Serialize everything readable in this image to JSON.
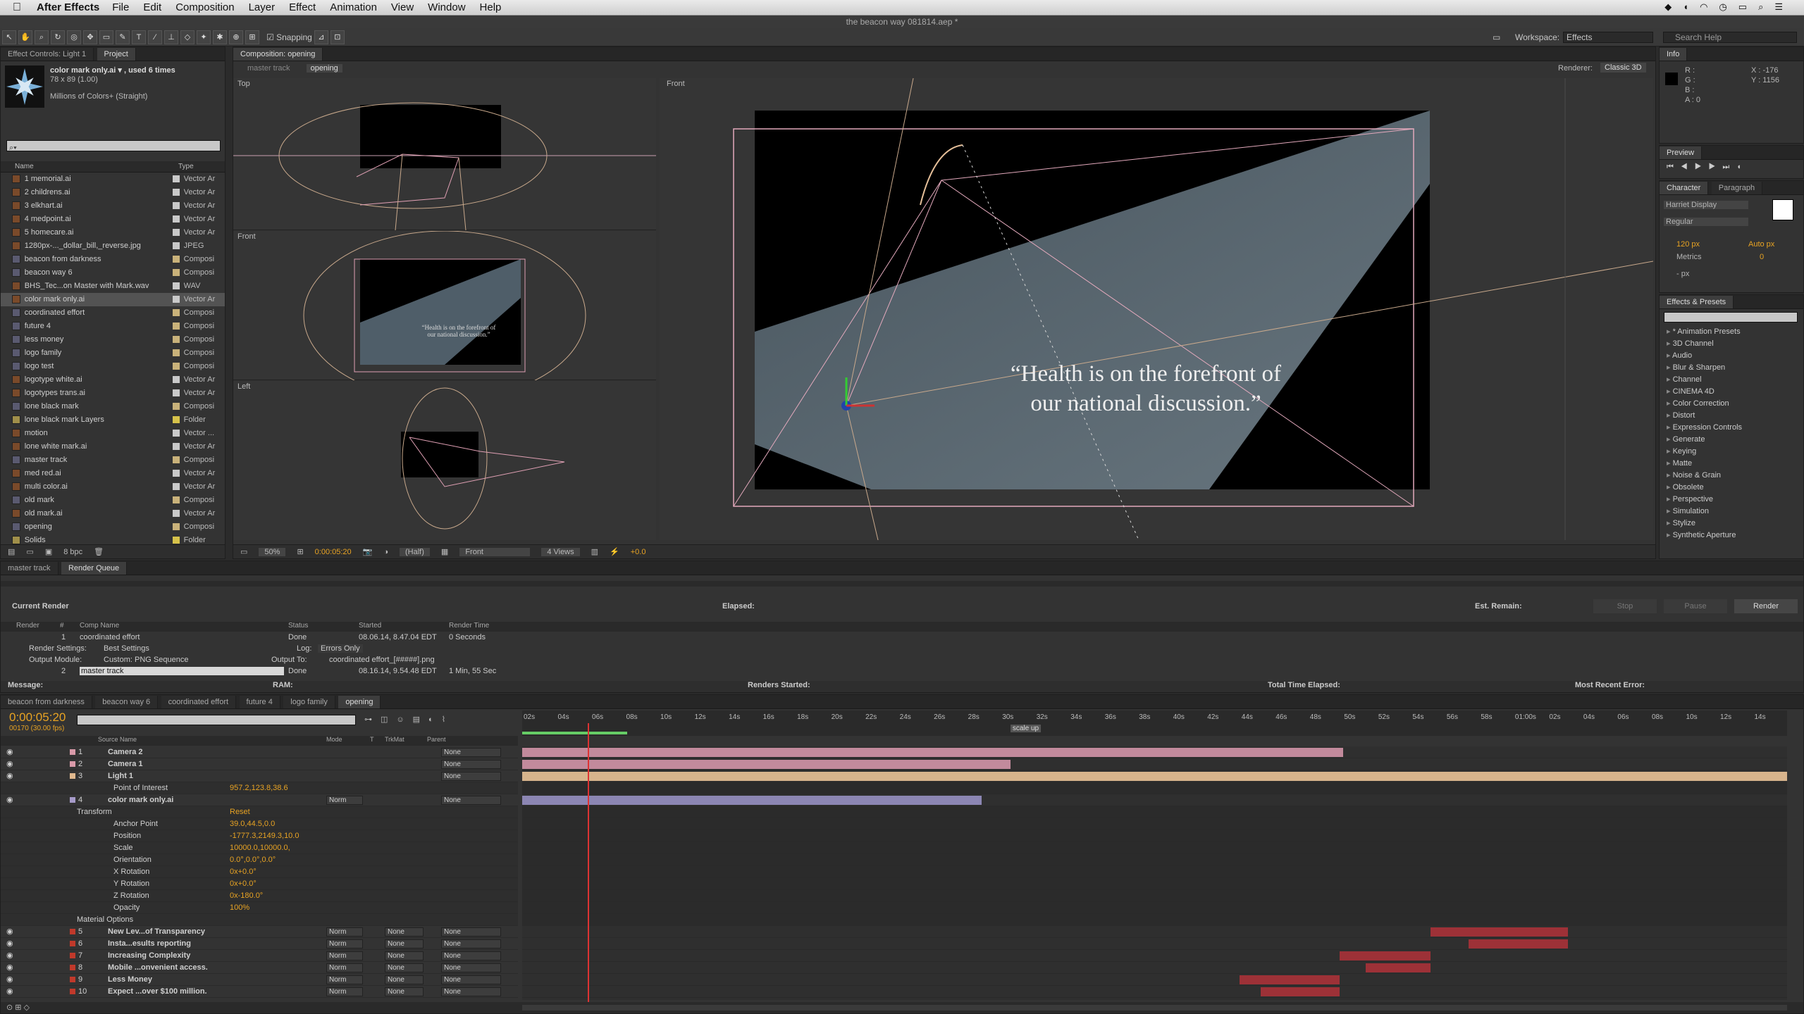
{
  "menubar": {
    "app": "After Effects",
    "items": [
      "File",
      "Edit",
      "Composition",
      "Layer",
      "Effect",
      "Animation",
      "View",
      "Window",
      "Help"
    ]
  },
  "window": {
    "title": "the beacon way 081814.aep *"
  },
  "toolbar": {
    "snapping": "Snapping",
    "workspace_label": "Workspace:",
    "workspace_value": "Effects",
    "search_help": "Search Help"
  },
  "project": {
    "tabs": [
      "Effect Controls: Light 1",
      "Project"
    ],
    "selected_item": {
      "name": "color mark only.ai ▾ , used 6 times",
      "dims": "78 x 89 (1.00)",
      "colors": "Millions of Colors+ (Straight)"
    },
    "col_name": "Name",
    "col_type": "Type",
    "items": [
      {
        "name": "1 memorial.ai",
        "type": "Vector Ar",
        "color": "#c9c9c9"
      },
      {
        "name": "2 childrens.ai",
        "type": "Vector Ar",
        "color": "#c9c9c9"
      },
      {
        "name": "3 elkhart.ai",
        "type": "Vector Ar",
        "color": "#c9c9c9"
      },
      {
        "name": "4 medpoint.ai",
        "type": "Vector Ar",
        "color": "#c9c9c9"
      },
      {
        "name": "5 homecare.ai",
        "type": "Vector Ar",
        "color": "#c9c9c9"
      },
      {
        "name": "1280px-..._dollar_bill,_reverse.jpg",
        "type": "JPEG",
        "color": "#c9c9c9"
      },
      {
        "name": "beacon from darkness",
        "type": "Composi",
        "color": "#c9b27a"
      },
      {
        "name": "beacon way 6",
        "type": "Composi",
        "color": "#c9b27a"
      },
      {
        "name": "BHS_Tec...on Master with Mark.wav",
        "type": "WAV",
        "color": "#c9c9c9"
      },
      {
        "name": "color mark only.ai",
        "type": "Vector Ar",
        "color": "#c9c9c9",
        "selected": true
      },
      {
        "name": "coordinated effort",
        "type": "Composi",
        "color": "#c9b27a"
      },
      {
        "name": "future 4",
        "type": "Composi",
        "color": "#c9b27a"
      },
      {
        "name": "less money",
        "type": "Composi",
        "color": "#c9b27a"
      },
      {
        "name": "logo family",
        "type": "Composi",
        "color": "#c9b27a"
      },
      {
        "name": "logo test",
        "type": "Composi",
        "color": "#c9b27a"
      },
      {
        "name": "logotype white.ai",
        "type": "Vector Ar",
        "color": "#c9c9c9"
      },
      {
        "name": "logotypes trans.ai",
        "type": "Vector Ar",
        "color": "#c9c9c9"
      },
      {
        "name": "lone black mark",
        "type": "Composi",
        "color": "#c9b27a"
      },
      {
        "name": "lone black mark Layers",
        "type": "Folder",
        "color": "#d6c24a"
      },
      {
        "name": "motion",
        "type": "Vector ...",
        "color": "#c9c9c9"
      },
      {
        "name": "lone white mark.ai",
        "type": "Vector Ar",
        "color": "#c9c9c9"
      },
      {
        "name": "master track",
        "type": "Composi",
        "color": "#c9b27a"
      },
      {
        "name": "med red.ai",
        "type": "Vector Ar",
        "color": "#c9c9c9"
      },
      {
        "name": "multi color.ai",
        "type": "Vector Ar",
        "color": "#c9c9c9"
      },
      {
        "name": "old mark",
        "type": "Composi",
        "color": "#c9b27a"
      },
      {
        "name": "old mark.ai",
        "type": "Vector Ar",
        "color": "#c9c9c9"
      },
      {
        "name": "opening",
        "type": "Composi",
        "color": "#c9b27a"
      },
      {
        "name": "Solids",
        "type": "Folder",
        "color": "#d6c24a"
      }
    ],
    "bpc": "8 bpc"
  },
  "comp": {
    "tab": "Composition: opening",
    "breadcrumbs": [
      "master track",
      "opening"
    ],
    "renderer_label": "Renderer:",
    "renderer": "Classic 3D",
    "views": {
      "top": "Top",
      "front_small": "Front",
      "left": "Left",
      "front_big": "Front"
    },
    "quote": "“Health is on the forefront of our national discussion.”",
    "quote_line1": "“Health is on the forefront of",
    "quote_line2": "our national discussion.”",
    "bottom": {
      "zoom": "50%",
      "time": "0:00:05:20",
      "res": "(Half)",
      "view": "Front",
      "layout": "4 Views",
      "exposure": "+0.0"
    }
  },
  "info": {
    "tab": "Info",
    "r": "R :",
    "g": "G :",
    "b": "B :",
    "a": "A : 0",
    "x": "X : -176",
    "y": "Y : 1156"
  },
  "preview": {
    "tab": "Preview"
  },
  "character": {
    "tabs": [
      "Character",
      "Paragraph"
    ],
    "font": "Harriet Display",
    "style": "Regular",
    "size": "120 px",
    "tracking_mode": "Metrics",
    "leading": "Auto px",
    "kerning": "0",
    "indent": "- px"
  },
  "effects": {
    "tab": "Effects & Presets",
    "items": [
      "* Animation Presets",
      "3D Channel",
      "Audio",
      "Blur & Sharpen",
      "Channel",
      "CINEMA 4D",
      "Color Correction",
      "Distort",
      "Expression Controls",
      "Generate",
      "Keying",
      "Matte",
      "Noise & Grain",
      "Obsolete",
      "Perspective",
      "Simulation",
      "Stylize",
      "Synthetic Aperture"
    ]
  },
  "render_queue": {
    "tabs": [
      "master track",
      "Render Queue"
    ],
    "current": "Current Render",
    "elapsed": "Elapsed:",
    "remain": "Est. Remain:",
    "stop": "Stop",
    "pause": "Pause",
    "render": "Render",
    "headers": [
      "Render",
      "#",
      "Comp Name",
      "Status",
      "Started",
      "Render Time"
    ],
    "row1": {
      "num": "1",
      "name": "coordinated effort",
      "status": "Done",
      "started": "08.06.14, 8.47.04 EDT",
      "time": "0 Seconds"
    },
    "settings": "Render Settings:",
    "settings_val": "Best Settings",
    "log": "Log:",
    "log_val": "Errors Only",
    "module": "Output Module:",
    "module_val": "Custom: PNG Sequence",
    "output": "Output To:",
    "output_val": "coordinated effort_[#####].png",
    "row2": {
      "num": "2",
      "name": "master track",
      "status": "Done",
      "started": "08.16.14, 9.54.48 EDT",
      "time": "1 Min, 55 Sec"
    },
    "footer": {
      "message": "Message:",
      "ram": "RAM:",
      "started": "Renders Started:",
      "total": "Total Time Elapsed:",
      "error": "Most Recent Error:"
    }
  },
  "timeline": {
    "tabs": [
      "beacon from darkness",
      "beacon way 6",
      "coordinated effort",
      "future 4",
      "logo family",
      "opening"
    ],
    "timecode": "0:00:05:20",
    "fps": "00170 (30.00 fps)",
    "cols": {
      "source": "Source Name",
      "mode": "Mode",
      "t": "T",
      "trkmat": "TrkMat",
      "parent": "Parent"
    },
    "ruler": [
      "02s",
      "04s",
      "06s",
      "08s",
      "10s",
      "12s",
      "14s",
      "16s",
      "18s",
      "20s",
      "22s",
      "24s",
      "26s",
      "28s",
      "30s",
      "32s",
      "34s",
      "36s",
      "38s",
      "40s",
      "42s",
      "44s",
      "46s",
      "48s",
      "50s",
      "52s",
      "54s",
      "56s",
      "58s",
      "01:00s",
      "02s",
      "04s",
      "06s",
      "08s",
      "10s",
      "12s",
      "14s"
    ],
    "marker": "scale up",
    "rows": [
      {
        "num": "1",
        "name": "Camera 2",
        "type": "layer",
        "label": "#d99aa9",
        "parent": "None"
      },
      {
        "num": "2",
        "name": "Camera 1",
        "type": "layer",
        "label": "#d99aa9",
        "parent": "None"
      },
      {
        "num": "3",
        "name": "Light 1",
        "type": "layer",
        "label": "#e0b88e",
        "parent": "None"
      },
      {
        "name": "Point of Interest",
        "value": "957.2,123.8,38.6",
        "type": "prop"
      },
      {
        "num": "4",
        "name": "color mark only.ai",
        "type": "layer",
        "label": "#a69bc9",
        "mode": "Norm",
        "parent": "None"
      },
      {
        "name": "Transform",
        "value": "Reset",
        "type": "group"
      },
      {
        "name": "Anchor Point",
        "value": "39.0,44.5,0.0",
        "type": "prop"
      },
      {
        "name": "Position",
        "value": "-1777.3,2149.3,10.0",
        "type": "prop"
      },
      {
        "name": "Scale",
        "value": "10000.0,10000.0,",
        "type": "prop"
      },
      {
        "name": "Orientation",
        "value": "0.0°,0.0°,0.0°",
        "type": "prop"
      },
      {
        "name": "X Rotation",
        "value": "0x+0.0°",
        "type": "prop"
      },
      {
        "name": "Y Rotation",
        "value": "0x+0.0°",
        "type": "prop"
      },
      {
        "name": "Z Rotation",
        "value": "0x-180.0°",
        "type": "prop"
      },
      {
        "name": "Opacity",
        "value": "100%",
        "type": "prop"
      },
      {
        "name": "Material Options",
        "type": "group"
      },
      {
        "num": "5",
        "name": "New Lev...of Transparency",
        "type": "layer",
        "label": "#c0392b",
        "mode": "Norm",
        "trk": "None",
        "parent": "None"
      },
      {
        "num": "6",
        "name": "Insta...esults reporting",
        "type": "layer",
        "label": "#c0392b",
        "mode": "Norm",
        "trk": "None",
        "parent": "None"
      },
      {
        "num": "7",
        "name": "Increasing Complexity",
        "type": "layer",
        "label": "#c0392b",
        "mode": "Norm",
        "trk": "None",
        "parent": "None"
      },
      {
        "num": "8",
        "name": "Mobile ...onvenient access.",
        "type": "layer",
        "label": "#c0392b",
        "mode": "Norm",
        "trk": "None",
        "parent": "None"
      },
      {
        "num": "9",
        "name": "Less Money",
        "type": "layer",
        "label": "#c0392b",
        "mode": "Norm",
        "trk": "None",
        "parent": "None"
      },
      {
        "num": "10",
        "name": "Expect ...over $100 million.",
        "type": "layer",
        "label": "#c0392b",
        "mode": "Norm",
        "trk": "None",
        "parent": "None"
      }
    ],
    "bars": [
      {
        "row": 0,
        "start": 0,
        "end": 0.649,
        "color": "#c28a9c"
      },
      {
        "row": 1,
        "start": 0,
        "end": 0.386,
        "color": "#c28a9c"
      },
      {
        "row": 2,
        "start": 0,
        "end": 1,
        "color": "#d7b48c"
      },
      {
        "row": 4,
        "start": 0,
        "end": 0.363,
        "color": "#8c86b3"
      },
      {
        "row": 15,
        "start": 0.718,
        "end": 0.827,
        "color": "#9d3137"
      },
      {
        "row": 16,
        "start": 0.748,
        "end": 0.827,
        "color": "#9d3137"
      },
      {
        "row": 17,
        "start": 0.646,
        "end": 0.718,
        "color": "#9d3137"
      },
      {
        "row": 18,
        "start": 0.667,
        "end": 0.718,
        "color": "#9d3137"
      },
      {
        "row": 19,
        "start": 0.567,
        "end": 0.646,
        "color": "#9d3137"
      },
      {
        "row": 20,
        "start": 0.584,
        "end": 0.646,
        "color": "#9d3137"
      }
    ],
    "playhead": 0.052
  }
}
